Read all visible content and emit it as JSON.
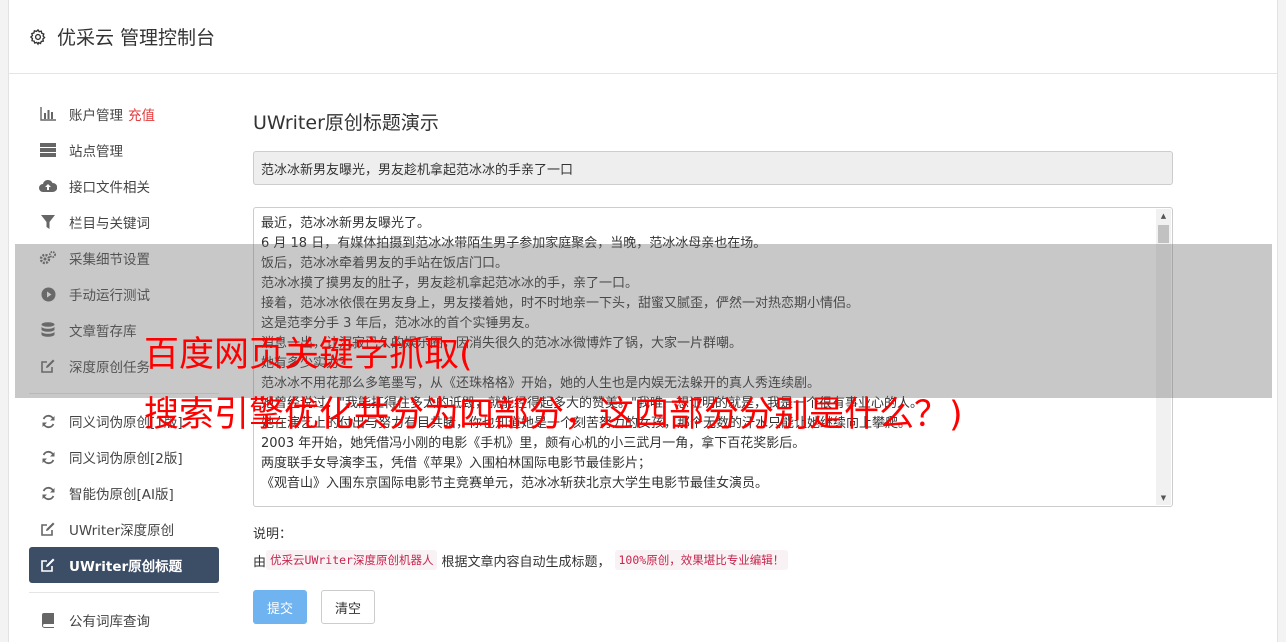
{
  "header": {
    "title": "优采云 管理控制台",
    "icon": "gear-icon"
  },
  "sidebar": {
    "group1": [
      {
        "label": "账户管理",
        "tag": "充值",
        "icon": "bar-chart-icon"
      },
      {
        "label": "站点管理",
        "icon": "server-icon"
      },
      {
        "label": "接口文件相关",
        "icon": "cloud-upload-icon"
      },
      {
        "label": "栏目与关键词",
        "icon": "filter-icon"
      },
      {
        "label": "采集细节设置",
        "icon": "cogs-icon"
      },
      {
        "label": "手动运行测试",
        "icon": "play-circle-icon"
      },
      {
        "label": "文章暂存库",
        "icon": "database-icon"
      },
      {
        "label": "深度原创任务",
        "icon": "edit-icon"
      }
    ],
    "group2": [
      {
        "label": "同义词伪原创[1版]",
        "icon": "refresh-icon"
      },
      {
        "label": "同义词伪原创[2版]",
        "icon": "refresh-icon"
      },
      {
        "label": "智能伪原创[AI版]",
        "icon": "refresh-icon"
      },
      {
        "label": "UWriter深度原创",
        "icon": "edit-icon"
      },
      {
        "label": "UWriter原创标题",
        "icon": "edit-icon",
        "active": true
      }
    ],
    "group3": [
      {
        "label": "公有词库查询",
        "icon": "book-icon"
      }
    ]
  },
  "main": {
    "heading": "UWriter原创标题演示",
    "title_value": "范冰冰新男友曝光，男友趁机拿起范冰冰的手亲了一口",
    "article_lines": [
      "最近，范冰冰新男友曝光了。",
      "6 月 18 日，有媒体拍摄到范冰冰带陌生男子参加家庭聚会，当晚，范冰冰母亲也在场。",
      "饭后，范冰冰牵着男友的手站在饭店门口。",
      "范冰冰摸了摸男友的肚子，男友趁机拿起范冰冰的手，亲了一口。",
      "接着，范冰冰依偎在男友身上，男友搂着她，时不时地亲一下头，甜蜜又腻歪，俨然一对热恋期小情侣。",
      "这是范李分手 3 年后，范冰冰的首个实锤男友。",
      "消息一出，让沉寂已久的娱乐圈，因消失很久的范冰冰微博炸了锅，大家一片群嘲。",
      "她有多少实力？",
      "范冰冰不用花那么多笔墨写，从《还珠格格》开始，她的人生也是内娱无法躲开的真人秀连续剧。",
      "她曾经说过：\"我能扛得住多大的诋毁，就能经得起多大的赞美。\"我唯一想证明的就是，我是一个很有事业心的人。",
      "她在演艺上的付出与努力有目共睹，你也知道她是一个刻苦努力的女孩，那个无数的汗水只能让她继续向上攀爬。",
      "2003 年开始，她凭借冯小刚的电影《手机》里，颇有心机的小三武月一角，拿下百花奖影后。",
      "两度联手女导演李玉，凭借《苹果》入围柏林国际电影节最佳影片；",
      "《观音山》入围东京国际电影节主竞赛单元，范冰冰斩获北京大学生电影节最佳女演员。"
    ],
    "note_label": "说明：",
    "note_prefix": "由",
    "note_code1": "优采云UWriter深度原创机器人",
    "note_middle": "根据文章内容自动生成标题，",
    "note_code2": "100%原创，效果堪比专业编辑！",
    "submit_label": "提交",
    "clear_label": "清空"
  },
  "overlay": {
    "line1": "百度网页关键字抓取(",
    "line2": "搜索引擎优化共分为四部分，这四部分分别是什么？)"
  }
}
